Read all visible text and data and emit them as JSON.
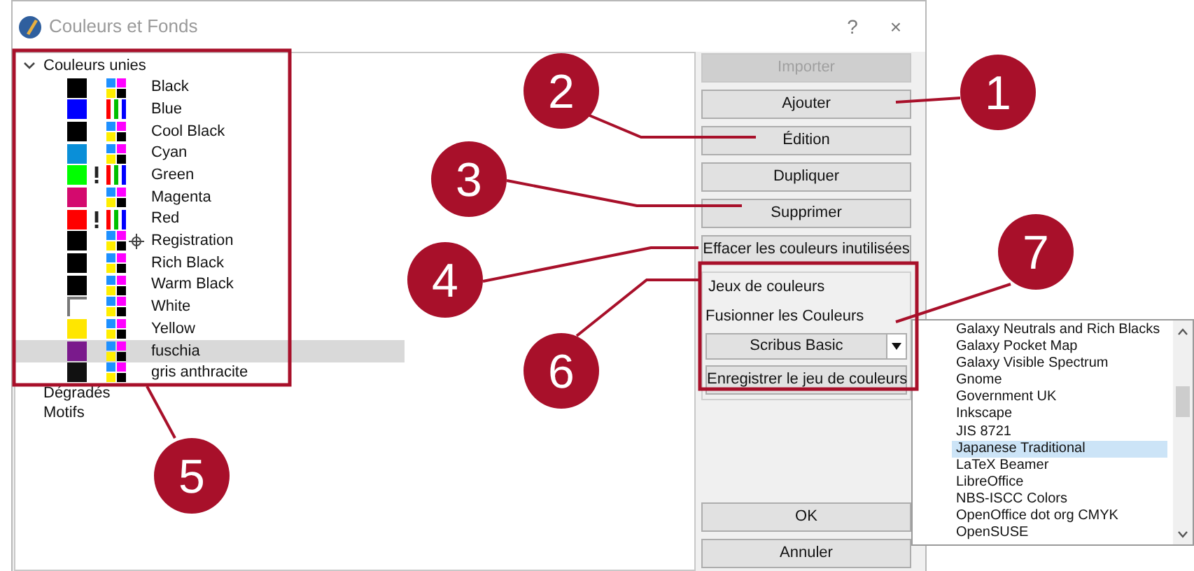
{
  "window": {
    "title": "Couleurs et Fonds",
    "help": "?",
    "close": "×"
  },
  "tree": [
    {
      "label": "Couleurs unies",
      "expanded": true,
      "children": [
        {
          "label": "Black",
          "color": "#000000",
          "kind": "cmyk",
          "out_of_gamut": false,
          "registration": false,
          "selected": false
        },
        {
          "label": "Blue",
          "color": "#0000ff",
          "kind": "rgb",
          "out_of_gamut": false,
          "registration": false,
          "selected": false
        },
        {
          "label": "Cool Black",
          "color": "#000000",
          "kind": "cmyk",
          "out_of_gamut": false,
          "registration": false,
          "selected": false
        },
        {
          "label": "Cyan",
          "color": "#0a8fd8",
          "kind": "cmyk",
          "out_of_gamut": false,
          "registration": false,
          "selected": false
        },
        {
          "label": "Green",
          "color": "#00ff00",
          "kind": "rgb",
          "out_of_gamut": true,
          "registration": false,
          "selected": false
        },
        {
          "label": "Magenta",
          "color": "#d40a6e",
          "kind": "cmyk",
          "out_of_gamut": false,
          "registration": false,
          "selected": false
        },
        {
          "label": "Red",
          "color": "#ff0000",
          "kind": "rgb",
          "out_of_gamut": true,
          "registration": false,
          "selected": false
        },
        {
          "label": "Registration",
          "color": "#000000",
          "kind": "cmyk",
          "out_of_gamut": false,
          "registration": true,
          "selected": false
        },
        {
          "label": "Rich Black",
          "color": "#000000",
          "kind": "cmyk",
          "out_of_gamut": false,
          "registration": false,
          "selected": false
        },
        {
          "label": "Warm Black",
          "color": "#000000",
          "kind": "cmyk",
          "out_of_gamut": false,
          "registration": false,
          "selected": false
        },
        {
          "label": "White",
          "color": "#ffffff",
          "kind": "cmyk",
          "out_of_gamut": false,
          "registration": false,
          "selected": false
        },
        {
          "label": "Yellow",
          "color": "#ffe600",
          "kind": "cmyk",
          "out_of_gamut": false,
          "registration": false,
          "selected": false
        },
        {
          "label": "fuschia",
          "color": "#7a1a8c",
          "kind": "cmyk",
          "out_of_gamut": false,
          "registration": false,
          "selected": true
        },
        {
          "label": "gris anthracite",
          "color": "#111111",
          "kind": "cmyk",
          "out_of_gamut": false,
          "registration": false,
          "selected": false
        }
      ]
    },
    {
      "label": "Dégradés"
    },
    {
      "label": "Motifs"
    }
  ],
  "buttons": [
    {
      "label": "Importer",
      "disabled": true
    },
    {
      "label": "Ajouter",
      "disabled": false
    },
    {
      "label": "Édition",
      "disabled": false
    },
    {
      "label": "Dupliquer",
      "disabled": false
    },
    {
      "label": "Supprimer",
      "disabled": false
    },
    {
      "label": "Effacer les couleurs inutilisées",
      "disabled": false
    }
  ],
  "color_sets": {
    "title": "Jeux de couleurs",
    "merge_label": "Fusionner les Couleurs",
    "combo_value": "Scribus Basic",
    "save_button": "Enregistrer le jeu de couleurs"
  },
  "dialog_buttons": [
    "OK",
    "Annuler"
  ],
  "dropdown_list": [
    {
      "label": "Galaxy Neutrals and Rich Blacks",
      "selected": false
    },
    {
      "label": "Galaxy Pocket Map",
      "selected": false
    },
    {
      "label": "Galaxy Visible Spectrum",
      "selected": false
    },
    {
      "label": "Gnome",
      "selected": false
    },
    {
      "label": "Government UK",
      "selected": false
    },
    {
      "label": "Inkscape",
      "selected": false
    },
    {
      "label": "JIS 8721",
      "selected": false
    },
    {
      "label": "Japanese Traditional",
      "selected": true
    },
    {
      "label": "LaTeX Beamer",
      "selected": false
    },
    {
      "label": "LibreOffice",
      "selected": false
    },
    {
      "label": "NBS-ISCC Colors",
      "selected": false
    },
    {
      "label": "OpenOffice dot org CMYK",
      "selected": false
    },
    {
      "label": "OpenSUSE",
      "selected": false
    }
  ],
  "callouts": [
    "1",
    "2",
    "3",
    "4",
    "5",
    "6",
    "7"
  ]
}
